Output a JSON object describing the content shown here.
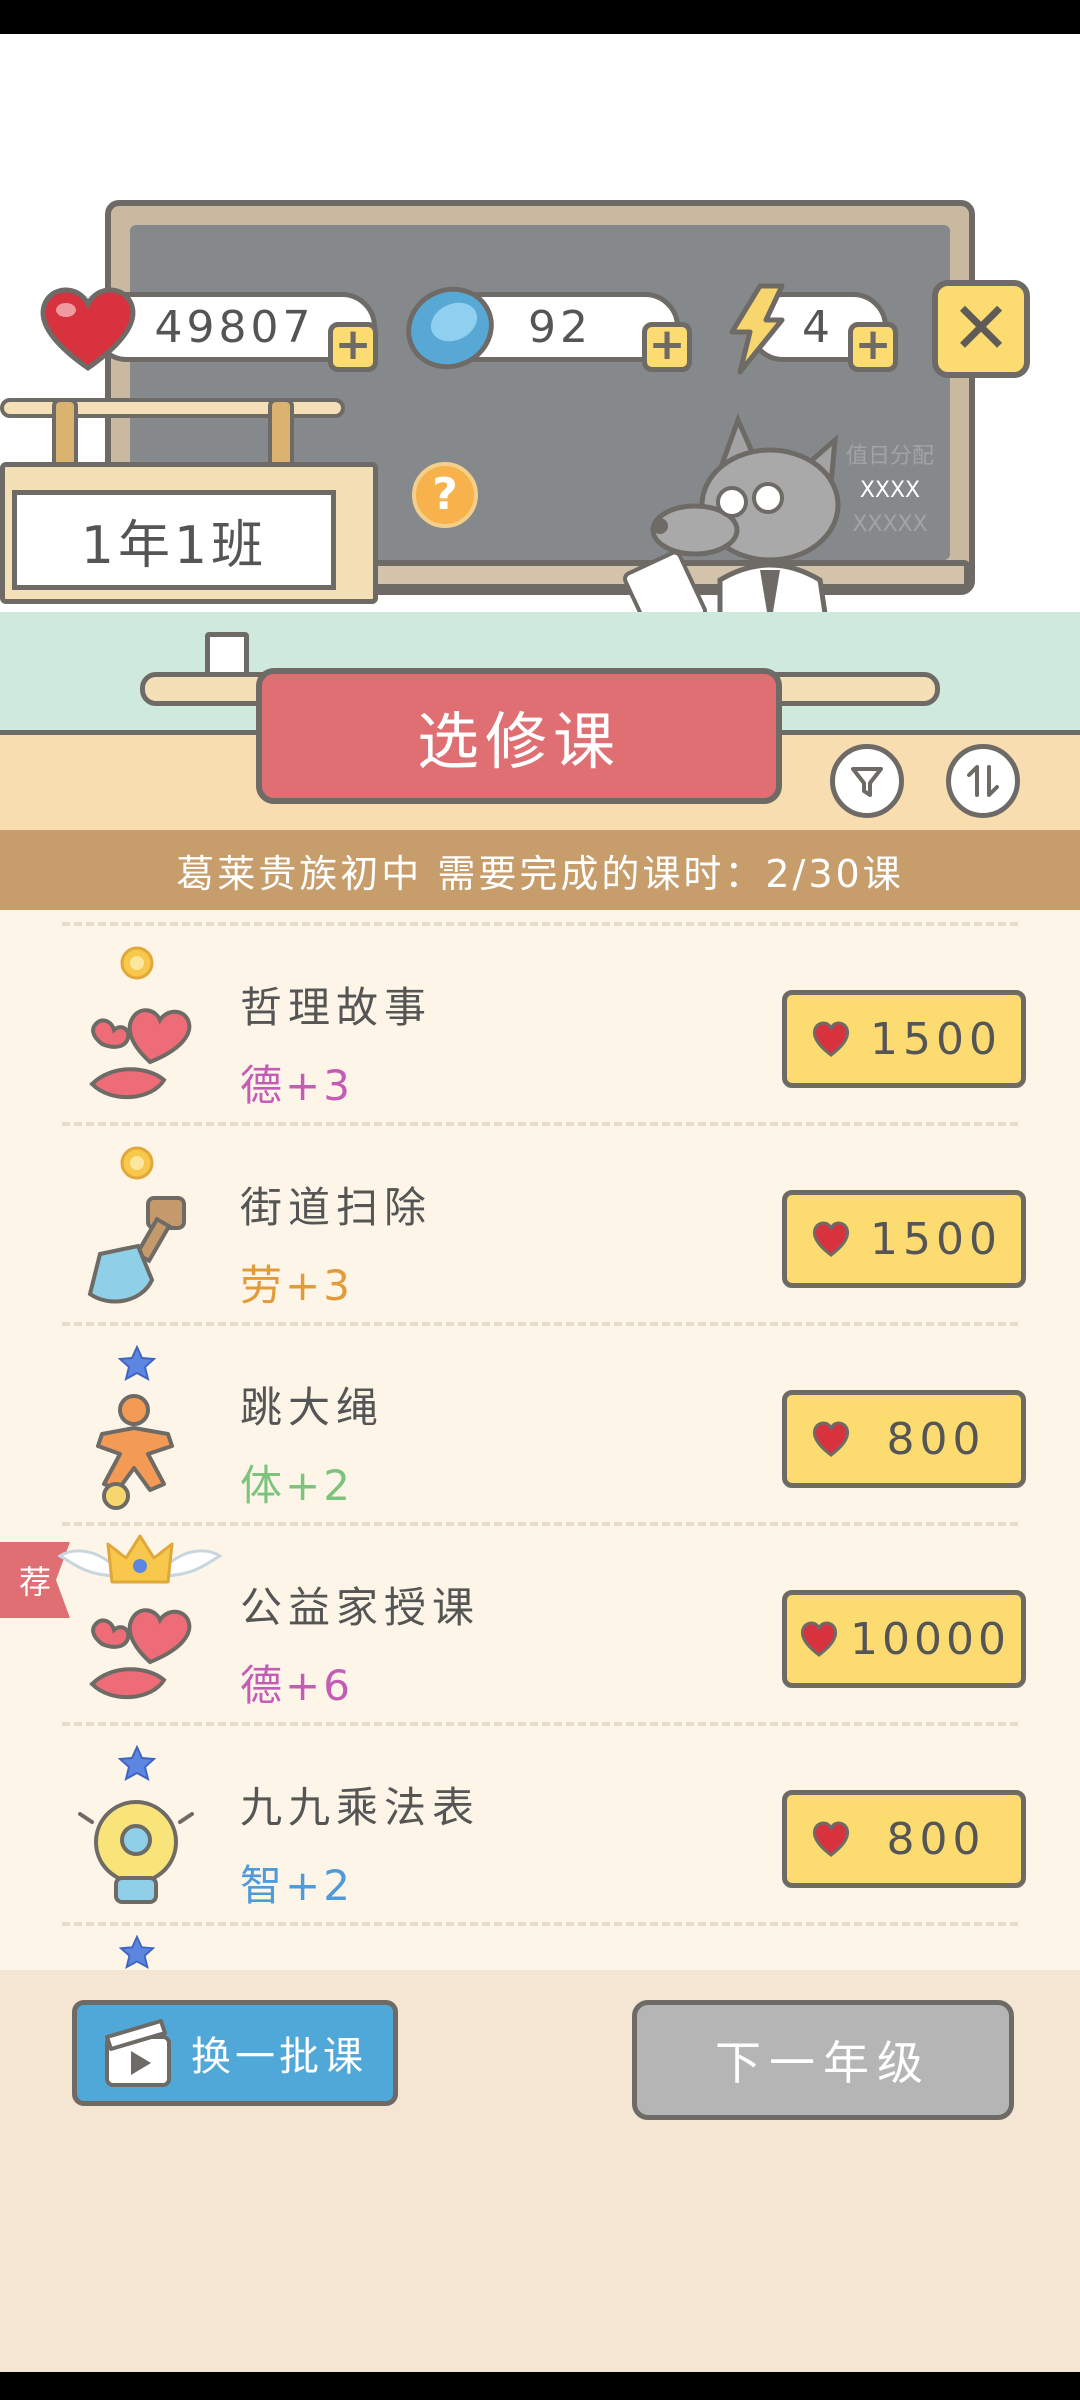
{
  "hud": {
    "hearts": "49807",
    "coins": "92",
    "energy": "4"
  },
  "classroom": {
    "class_sign": "1年1班",
    "board_lines": [
      "值日分配",
      "XXXX",
      "XXXXX"
    ],
    "title": "选修课"
  },
  "info_bar": "葛莱贵族初中 需要完成的课时：2/30课",
  "courses": [
    {
      "name": "哲理故事",
      "stat": "德+3",
      "stat_color": "#c45bb5",
      "price": "1500",
      "badge": "sun"
    },
    {
      "name": "街道扫除",
      "stat": "劳+3",
      "stat_color": "#e39b3a",
      "price": "1500",
      "badge": "sun"
    },
    {
      "name": "跳大绳",
      "stat": "体+2",
      "stat_color": "#7cc47e",
      "price": "800",
      "badge": "star"
    },
    {
      "name": "公益家授课",
      "stat": "德+6",
      "stat_color": "#c45bb5",
      "price": "10000",
      "badge": "crown",
      "tag": "荐"
    },
    {
      "name": "九九乘法表",
      "stat": "智+2",
      "stat_color": "#4f9ad8",
      "price": "800",
      "badge": "star"
    }
  ],
  "buttons": {
    "refresh": "换一批课",
    "next_grade": "下一年级"
  },
  "colors": {
    "accent_yellow": "#fcdc70",
    "banner_red": "#e06f74",
    "outline": "#6e6a66"
  }
}
